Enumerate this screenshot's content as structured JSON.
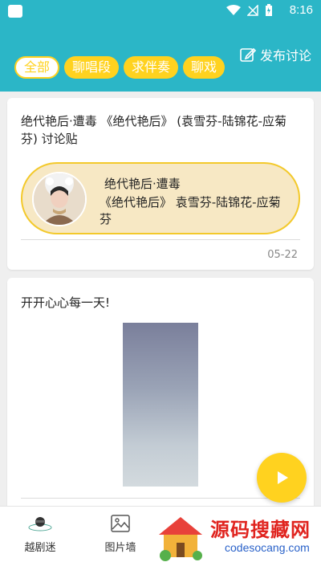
{
  "status_bar": {
    "time": "8:16"
  },
  "header": {
    "tabs": [
      {
        "label": "全部",
        "active": true
      },
      {
        "label": "聊唱段",
        "active": false
      },
      {
        "label": "求伴奏",
        "active": false
      },
      {
        "label": "聊戏",
        "active": false
      }
    ],
    "post_button": "发布讨论"
  },
  "posts": [
    {
      "title": "绝代艳后·遭毒 《绝代艳后》 (袁雪芬-陆锦花-应菊芬) 讨论贴",
      "pill_line1": "绝代艳后·遭毒",
      "pill_line2": "《绝代艳后》 袁雪芬-陆锦花-应菊芬",
      "date": "05-22"
    },
    {
      "title": "开开心心每一天!"
    }
  ],
  "bottom_nav": [
    {
      "label": "越剧迷",
      "icon": "opera-mask-icon"
    },
    {
      "label": "图片墙",
      "icon": "image-icon"
    }
  ],
  "watermark": {
    "title": "源码搜藏网",
    "url": "codesocang.com"
  },
  "colors": {
    "header": "#2bb6c7",
    "accent": "#ffd21f"
  }
}
